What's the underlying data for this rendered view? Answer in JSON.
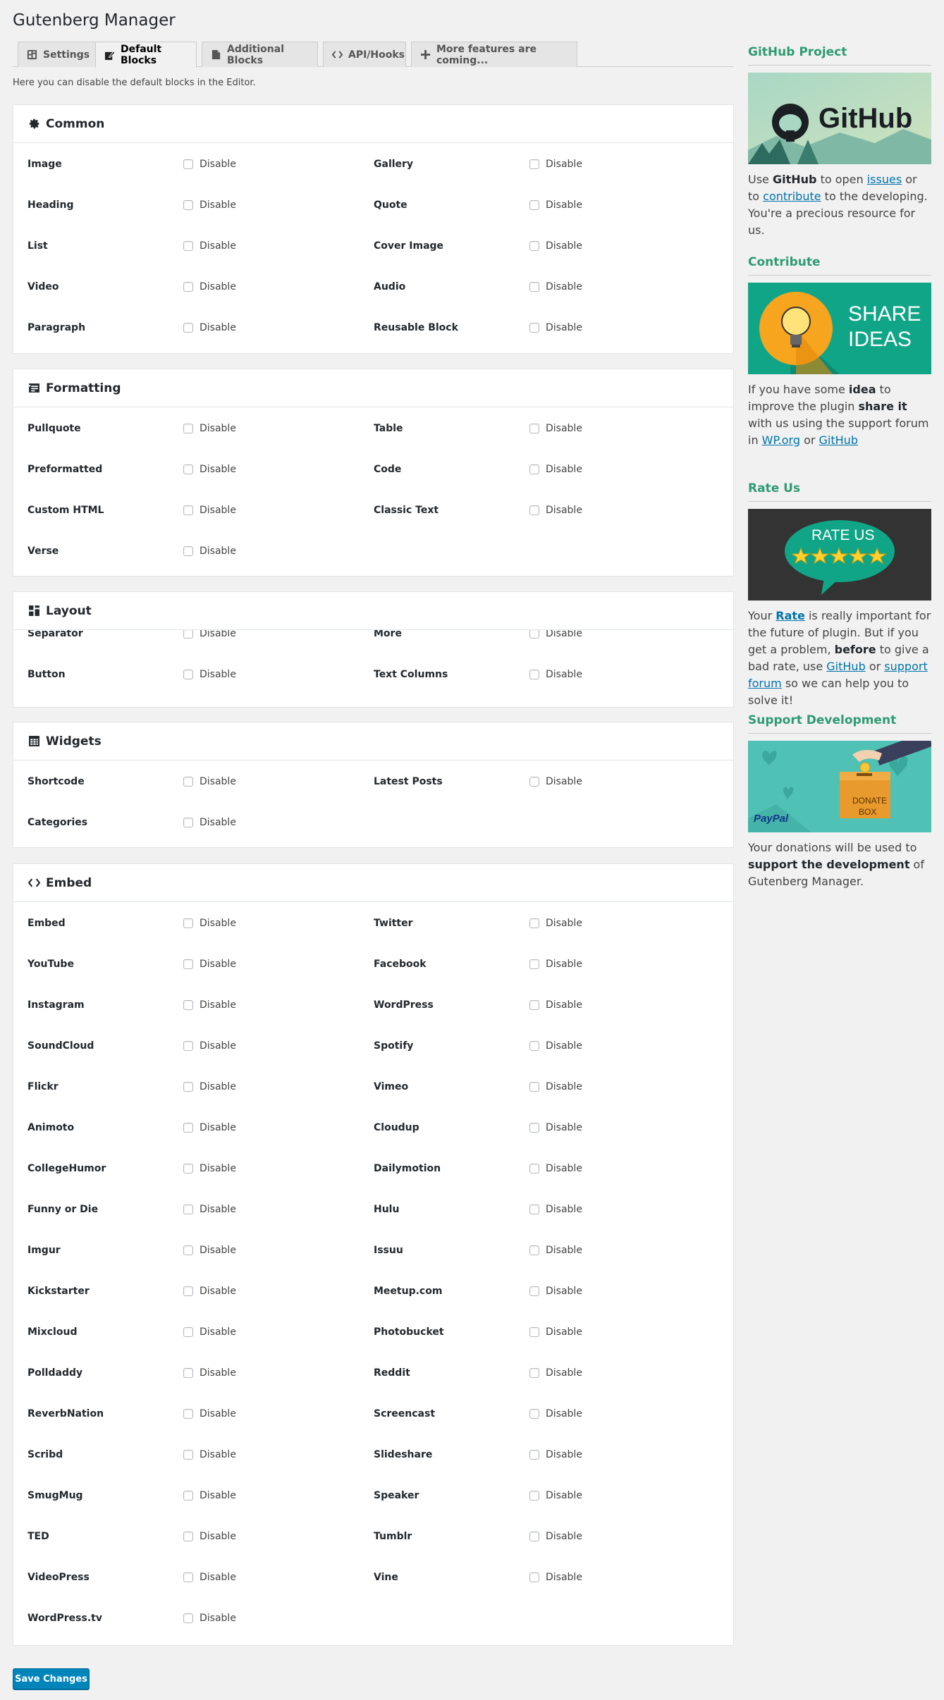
{
  "page_title": "Gutenberg Manager",
  "tabs": [
    {
      "label": "Settings",
      "icon": "dashboard-icon"
    },
    {
      "label": "Default Blocks",
      "icon": "edit-icon",
      "active": true
    },
    {
      "label": "Additional Blocks",
      "icon": "page-icon"
    },
    {
      "label": "API/Hooks",
      "icon": "code-icon"
    },
    {
      "label": "More features are coming...",
      "icon": "plus-icon"
    }
  ],
  "intro": "Here you can disable the default blocks in the Editor.",
  "disable_label": "Disable",
  "sections": {
    "common": {
      "title": "Common",
      "icon": "gear-icon",
      "items": [
        "Image",
        "Gallery",
        "Heading",
        "Quote",
        "List",
        "Cover Image",
        "Video",
        "Audio",
        "Paragraph",
        "Reusable Block"
      ]
    },
    "formatting": {
      "title": "Formatting",
      "icon": "text-align-icon",
      "items": [
        "Pullquote",
        "Table",
        "Preformatted",
        "Code",
        "Custom HTML",
        "Classic Text",
        "Verse"
      ]
    },
    "layout": {
      "title": "Layout",
      "icon": "columns-icon",
      "items": [
        "Separator",
        "More",
        "Button",
        "Text Columns"
      ]
    },
    "widgets": {
      "title": "Widgets",
      "icon": "grid-icon",
      "items": [
        "Shortcode",
        "Latest Posts",
        "Categories"
      ]
    },
    "embed": {
      "title": "Embed",
      "icon": "code-icon",
      "items": [
        "Embed",
        "Twitter",
        "YouTube",
        "Facebook",
        "Instagram",
        "WordPress",
        "SoundCloud",
        "Spotify",
        "Flickr",
        "Vimeo",
        "Animoto",
        "Cloudup",
        "CollegeHumor",
        "Dailymotion",
        "Funny or Die",
        "Hulu",
        "Imgur",
        "Issuu",
        "Kickstarter",
        "Meetup.com",
        "Mixcloud",
        "Photobucket",
        "Polldaddy",
        "Reddit",
        "ReverbNation",
        "Screencast",
        "Scribd",
        "Slideshare",
        "SmugMug",
        "Speaker",
        "TED",
        "Tumblr",
        "VideoPress",
        "Vine",
        "WordPress.tv"
      ]
    }
  },
  "save_label": "Save Changes",
  "sidebar": {
    "github": {
      "title": "GitHub Project",
      "image_text": "GitHub",
      "p1": "Use ",
      "b1": "GitHub",
      "p2": " to open ",
      "link_issues": "issues",
      "p3": " or to ",
      "link_contribute": "contribute",
      "p4": " to the developing. You're a precious resource for us."
    },
    "contribute": {
      "title": "Contribute",
      "image_line1": "SHARE",
      "image_line2": "IDEAS",
      "p1": "If you have some ",
      "b1": "idea",
      "p2": " to improve the plugin ",
      "b2": "share it",
      "p3": " with us using the support forum in ",
      "link_wporg": "WP.org",
      "p4": " or ",
      "link_github": "GitHub"
    },
    "rate": {
      "title": "Rate Us",
      "image_text": "RATE US",
      "p1": "Your ",
      "link_rate": "Rate",
      "p2": " is really important for the future of plugin. But if you get a problem, ",
      "b1": "before",
      "p3": " to give a bad rate, use ",
      "link_github": "GitHub",
      "p4": " or ",
      "link_support": "support forum",
      "p5": " so we can help you to solve it!"
    },
    "support": {
      "title": "Support Development",
      "image_line1": "DONATE",
      "image_line2": "BOX",
      "image_paypal": "PayPal",
      "p1": "Your donations will be used to ",
      "b1": "support the development",
      "p2": " of Gutenberg Manager."
    }
  },
  "colors": {
    "accent_green": "#2e9b74",
    "link_blue": "#0073aa",
    "button_blue": "#0085ba"
  }
}
